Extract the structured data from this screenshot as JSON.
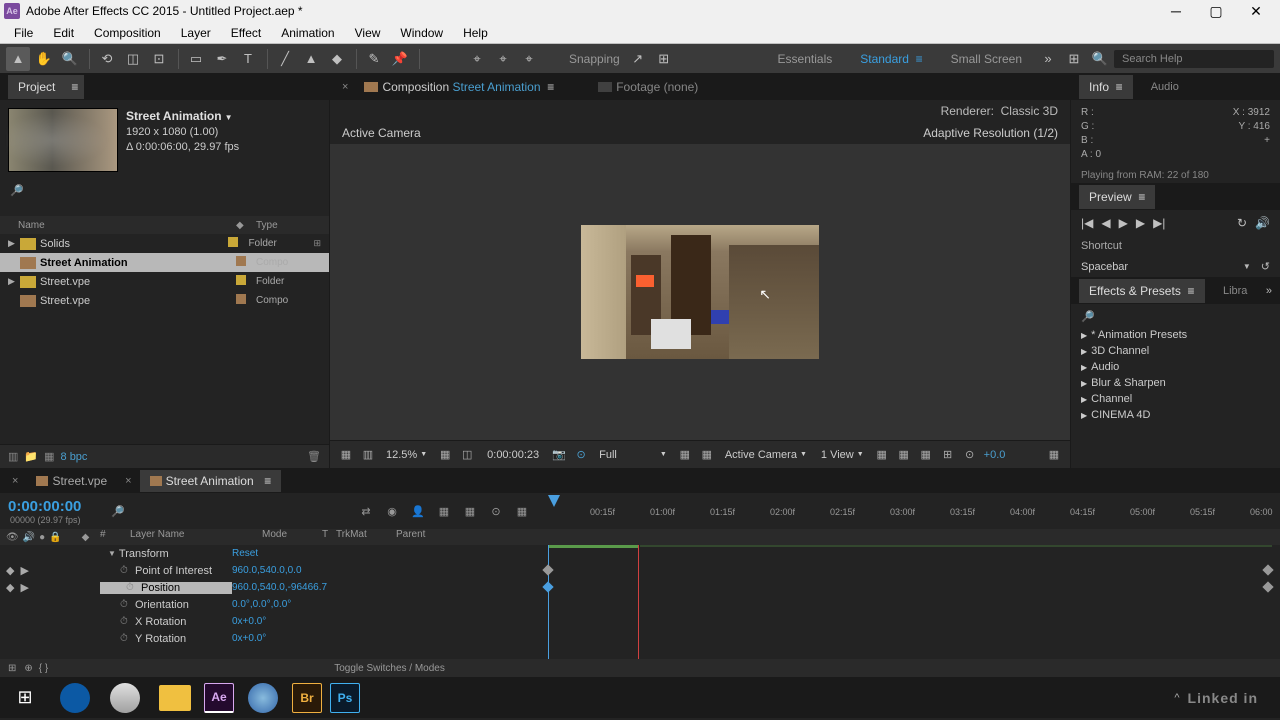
{
  "title_bar": {
    "app_icon_text": "Ae",
    "title": "Adobe After Effects CC 2015 - Untitled Project.aep *"
  },
  "menu_bar": [
    "File",
    "Edit",
    "Composition",
    "Layer",
    "Effect",
    "Animation",
    "View",
    "Window",
    "Help"
  ],
  "tool_bar": {
    "snapping_label": "Snapping",
    "workspaces": {
      "essentials": "Essentials",
      "standard": "Standard",
      "small_screen": "Small Screen"
    },
    "search_placeholder": "Search Help"
  },
  "project_panel": {
    "tab": "Project",
    "comp_name": "Street Animation",
    "comp_resolution": "1920 x 1080 (1.00)",
    "comp_duration": "Δ 0:00:06:00, 29.97 fps",
    "search_icon": "🔎",
    "columns": {
      "name": "Name",
      "type": "Type"
    },
    "items": [
      {
        "name": "Solids",
        "type": "Folder",
        "icon": "folder",
        "twisty": "▶"
      },
      {
        "name": "Street Animation",
        "type": "Compo",
        "icon": "comp",
        "selected": true
      },
      {
        "name": "Street.vpe",
        "type": "Folder",
        "icon": "folder",
        "twisty": "▶"
      },
      {
        "name": "Street.vpe",
        "type": "Compo",
        "icon": "comp"
      }
    ],
    "footer": {
      "bpc": "8 bpc"
    }
  },
  "comp_panel": {
    "close_x": "×",
    "tab_comp_label": "Composition",
    "tab_comp_name": "Street Animation",
    "tab_footage_label": "Footage",
    "tab_footage_name": "(none)",
    "renderer_label": "Renderer:",
    "renderer_value": "Classic 3D",
    "active_camera": "Active Camera",
    "adaptive_res": "Adaptive Resolution (1/2)",
    "footer": {
      "zoom": "12.5%",
      "timecode": "0:00:00:23",
      "resolution": "Full",
      "camera": "Active Camera",
      "views": "1 View",
      "exposure": "+0.0"
    }
  },
  "right_panels": {
    "info": {
      "tab_info": "Info",
      "tab_audio": "Audio",
      "r": "R :",
      "g": "G :",
      "b": "B :",
      "a": "A : 0",
      "x": "X : 3912",
      "y": "Y :   416",
      "ram_msg": "Playing from RAM: 22 of 180"
    },
    "preview": {
      "tab": "Preview",
      "shortcut_label": "Shortcut",
      "shortcut_value": "Spacebar"
    },
    "effects": {
      "tab": "Effects & Presets",
      "tab2": "Libra",
      "search_icon": "🔎",
      "list": [
        "* Animation Presets",
        "3D Channel",
        "Audio",
        "Blur & Sharpen",
        "Channel",
        "CINEMA 4D"
      ]
    }
  },
  "timeline": {
    "tabs": {
      "street_vpe": "Street.vpe",
      "street_anim": "Street Animation"
    },
    "time": "0:00:00:00",
    "frames": "00000 (29.97 fps)",
    "ruler_ticks": [
      "00:15f",
      "01:00f",
      "01:15f",
      "02:00f",
      "02:15f",
      "03:00f",
      "03:15f",
      "04:00f",
      "04:15f",
      "05:00f",
      "05:15f",
      "06:00"
    ],
    "columns": {
      "num": "#",
      "name": "Layer Name",
      "mode": "Mode",
      "t": "T",
      "trkmat": "TrkMat",
      "parent": "Parent"
    },
    "rows": [
      {
        "type": "transform",
        "name": "Transform",
        "value": "Reset"
      },
      {
        "type": "prop",
        "name": "Point of Interest",
        "value": "960.0,540.0,0.0",
        "stopwatch": true,
        "keyed": true
      },
      {
        "type": "prop",
        "name": "Position",
        "value": "960.0,540.0,-96466.7",
        "stopwatch": true,
        "keyed": true,
        "selected": true
      },
      {
        "type": "prop",
        "name": "Orientation",
        "value": "0.0°,0.0°,0.0°",
        "stopwatch": true
      },
      {
        "type": "prop",
        "name": "X Rotation",
        "value": "0x+0.0°",
        "stopwatch": true
      },
      {
        "type": "prop",
        "name": "Y Rotation",
        "value": "0x+0.0°",
        "stopwatch": true
      }
    ],
    "footer_toggle": "Toggle Switches / Modes"
  },
  "taskbar": {
    "ae": "Ae",
    "br": "Br",
    "ps": "Ps",
    "linked": "Linked in"
  }
}
